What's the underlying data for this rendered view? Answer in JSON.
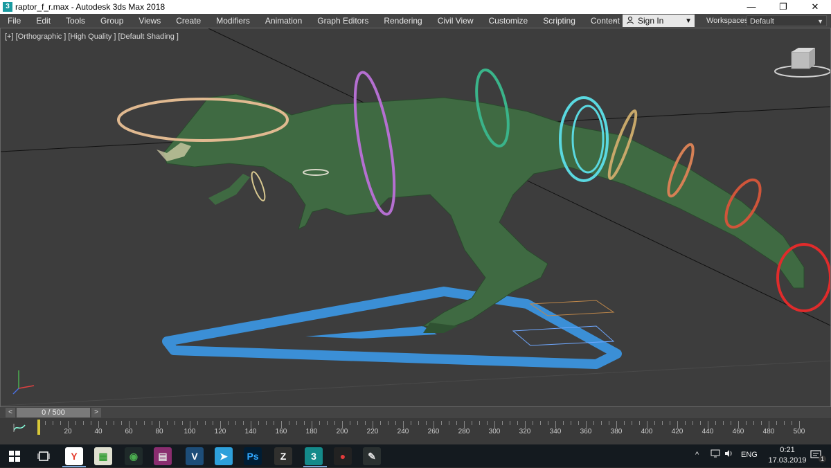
{
  "titlebar": {
    "title": "raptor_f_r.max - Autodesk 3ds Max 2018",
    "app_icon_glyph": "3",
    "minimize": "—",
    "restore": "❐",
    "close": "✕"
  },
  "menubar": {
    "items": [
      "File",
      "Edit",
      "Tools",
      "Group",
      "Views",
      "Create",
      "Modifiers",
      "Animation",
      "Graph Editors",
      "Rendering",
      "Civil View",
      "Customize",
      "Scripting",
      "Content"
    ],
    "more_glyph": "»"
  },
  "signin": {
    "label": "Sign In",
    "icon": "user-icon"
  },
  "workspaces": {
    "label": "Workspaces:",
    "value": "Default"
  },
  "viewport": {
    "label": "[+] [Orthographic ] [High Quality ] [Default Shading ]",
    "viewcube_icon": "viewcube-icon",
    "axis_icon": "axis-gizmo-icon"
  },
  "timeline": {
    "prev": "<",
    "next": ">",
    "frame_display": "0 / 500",
    "current_frame": 0,
    "total_frames": 500,
    "ruler_labels": [
      "20",
      "40",
      "60",
      "80",
      "100",
      "120",
      "140",
      "160",
      "180",
      "200",
      "220",
      "240",
      "260",
      "280",
      "300",
      "320",
      "340",
      "360",
      "380",
      "400",
      "420",
      "440",
      "460",
      "480",
      "500"
    ]
  },
  "taskbar": {
    "apps": [
      {
        "name": "yandex-browser-icon",
        "glyph": "Y",
        "color": "#e43b2c",
        "bg": "#ffffff"
      },
      {
        "name": "spreadsheet-icon",
        "glyph": "▦",
        "color": "#3a9f3a",
        "bg": "#e0e0d0"
      },
      {
        "name": "maps-icon",
        "glyph": "◉",
        "color": "#4caf50",
        "bg": "#1f2a2a"
      },
      {
        "name": "winrar-icon",
        "glyph": "▤",
        "color": "#e0e0e0",
        "bg": "#8a2d6f"
      },
      {
        "name": "v-app-icon",
        "glyph": "V",
        "color": "#ffffff",
        "bg": "#1d4d78"
      },
      {
        "name": "telegram-icon",
        "glyph": "➤",
        "color": "#ffffff",
        "bg": "#2ea0db"
      },
      {
        "name": "photoshop-icon",
        "glyph": "Ps",
        "color": "#31a8ff",
        "bg": "#001d34"
      },
      {
        "name": "zbrush-icon",
        "glyph": "Z",
        "color": "#ffffff",
        "bg": "#30302e"
      },
      {
        "name": "3dsmax-icon",
        "glyph": "3",
        "color": "#ffffff",
        "bg": "#148a8a"
      },
      {
        "name": "recorder-icon",
        "glyph": "●",
        "color": "#e33b3b",
        "bg": "#222222"
      },
      {
        "name": "paint-icon",
        "glyph": "✎",
        "color": "#e0e0e0",
        "bg": "#2a3030"
      }
    ],
    "tray": {
      "language": "ENG",
      "time": "0:21",
      "date": "17.03.2019",
      "notification_count": "1"
    }
  }
}
